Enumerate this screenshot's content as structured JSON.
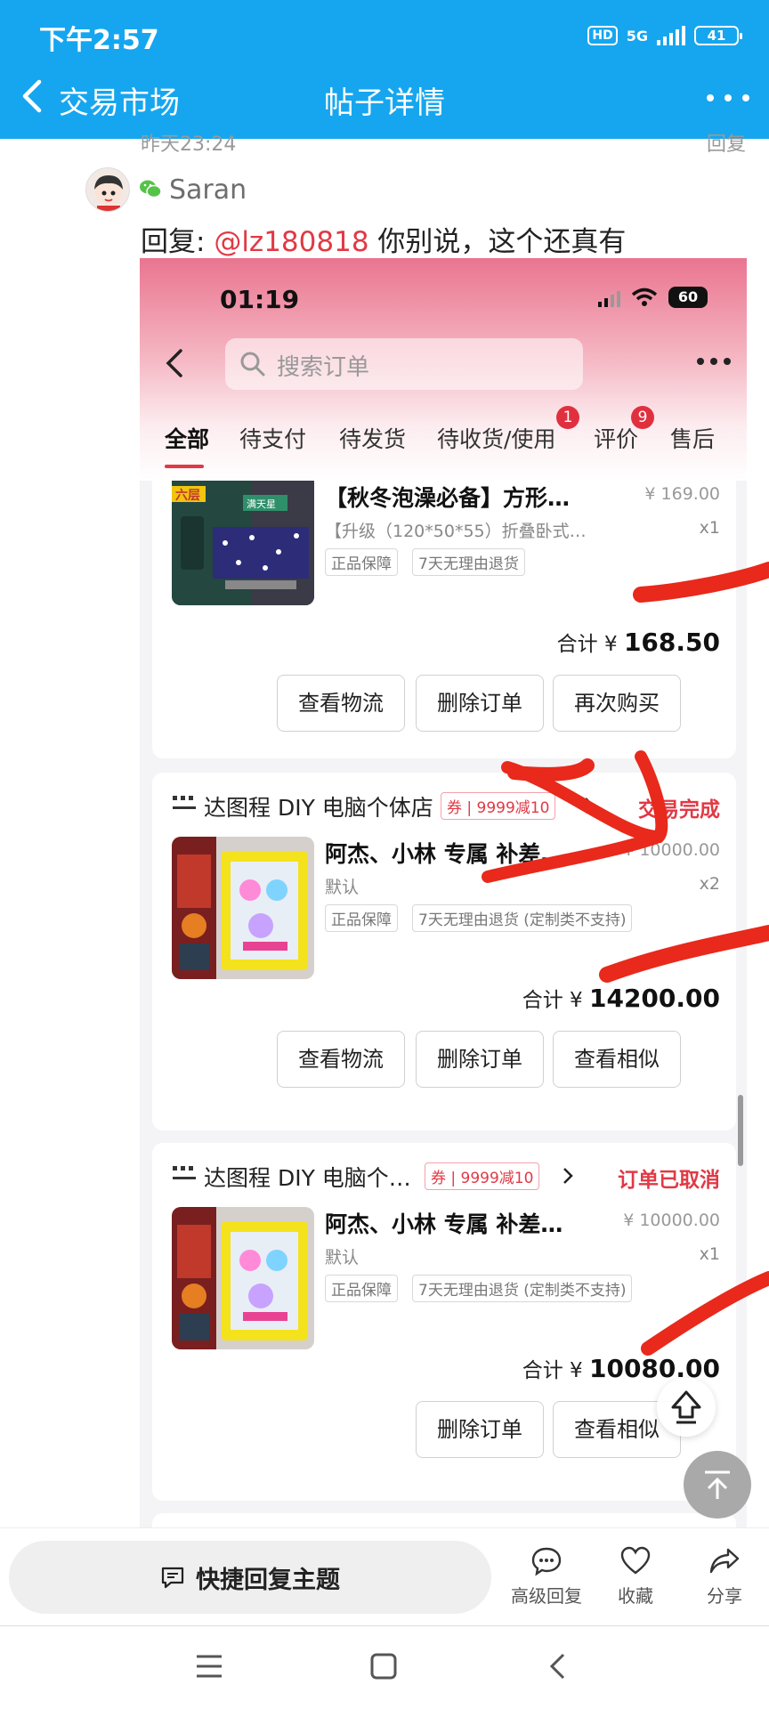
{
  "status_bar": {
    "time": "下午2:57",
    "network": "5G",
    "hd": "HD",
    "battery": "41"
  },
  "nav": {
    "back_label": "交易市场",
    "title": "帖子详情"
  },
  "post_meta": {
    "time_clipped": "昨天23:24",
    "reply_clipped": "回复"
  },
  "comment": {
    "user": "Saran",
    "prefix": "回复: ",
    "mention": "@lz180818",
    "text": " 你别说，这个还真有"
  },
  "screenshot": {
    "time": "01:19",
    "battery": "60",
    "search_placeholder": "搜索订单",
    "tabs": [
      {
        "label": "全部"
      },
      {
        "label": "待支付"
      },
      {
        "label": "待发货"
      },
      {
        "label": "待收货/使用",
        "badge": "1"
      },
      {
        "label": "评价",
        "badge": "9"
      },
      {
        "label": "售后"
      }
    ],
    "orders": [
      {
        "title": "【秋冬泡澡必备】方形…",
        "price": "¥ 169.00",
        "spec": "【升级（120*50*55）折叠卧式…",
        "qty": "x1",
        "tags": [
          "正品保障",
          "7天无理由退货"
        ],
        "total_label": "合计 ¥",
        "total": "168.50",
        "buttons": [
          "查看物流",
          "删除订单",
          "再次购买"
        ],
        "thumb_text": {
          "a": "六层",
          "b": "满天星"
        }
      },
      {
        "shop": "达图程 DIY 电脑个体店",
        "coupon_label": "券",
        "coupon": "9999减10",
        "status": "交易完成",
        "title": "阿杰、小林 专属 补差…",
        "price": "¥ 10000.00",
        "spec": "默认",
        "qty": "x2",
        "tags": [
          "正品保障",
          "7天无理由退货 (定制类不支持)"
        ],
        "total_label": "合计 ¥",
        "total": "14200.00",
        "buttons": [
          "查看物流",
          "删除订单",
          "查看相似"
        ]
      },
      {
        "shop": "达图程 DIY 电脑个…",
        "coupon_label": "券",
        "coupon": "9999减10",
        "status": "订单已取消",
        "title": "阿杰、小林 专属 补差…",
        "price": "¥ 10000.00",
        "spec": "默认",
        "qty": "x1",
        "tags": [
          "正品保障",
          "7天无理由退货 (定制类不支持)"
        ],
        "total_label": "合计 ¥",
        "total": "10080.00",
        "buttons": [
          "删除订单",
          "查看相似"
        ]
      }
    ]
  },
  "bottom": {
    "quick_reply": "快捷回复主题",
    "actions": [
      {
        "label": "高级回复",
        "icon": "chat-bubble-icon"
      },
      {
        "label": "收藏",
        "icon": "heart-icon"
      },
      {
        "label": "分享",
        "icon": "share-icon"
      }
    ]
  },
  "colors": {
    "app_blue": "#16a6ef",
    "accent_red": "#e13945",
    "annotation_red": "#e8291b"
  }
}
